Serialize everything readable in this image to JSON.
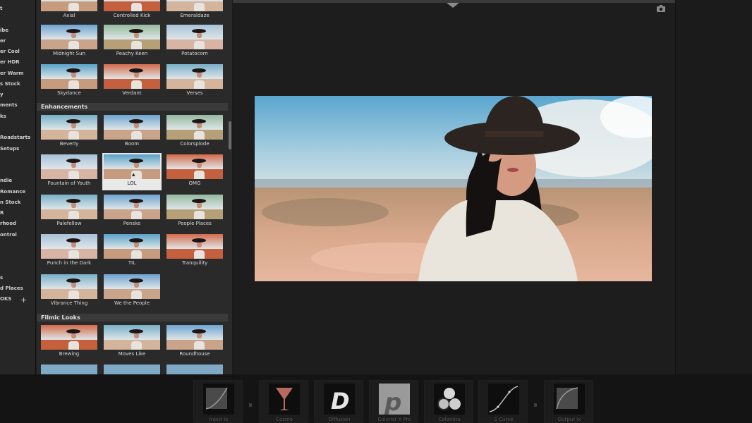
{
  "sidebar": {
    "categories": [
      "t",
      "ibe",
      "er",
      "er Cool",
      "er HDR",
      "er Warm",
      "s Stock",
      "y",
      "ments",
      "ks",
      "Roadstarts",
      "Setups",
      "ndie",
      "Romance",
      "n Stock",
      "R",
      "rhood",
      "ontrol",
      "s",
      "d Places",
      "OKS"
    ],
    "add_label": "+"
  },
  "browser": {
    "row0": [
      "Axial",
      "Controlled Kick",
      "Emeraldaze"
    ],
    "row1": [
      "Midnight Sun",
      "Peachy Keen",
      "Potatocorn"
    ],
    "row2": [
      "Skydance",
      "Verdant",
      "Verses"
    ],
    "section_enhancements": "Enhancements",
    "enh": [
      "Beverly",
      "Boom",
      "Colorsplode",
      "Fountain of Youth",
      "LOL",
      "OMG",
      "Palefellow",
      "Penske",
      "People Places",
      "Punch in the Dark",
      "TIL",
      "Tranquility",
      "Vibrance Thing",
      "We the People"
    ],
    "section_filmic": "Filmic Looks",
    "filmic": [
      "Brewing",
      "Moves Like",
      "Roundhouse"
    ]
  },
  "tools": [
    "Input Ix",
    "Cosmo",
    "Diffusion",
    "Colorist X Pro",
    "Colorista",
    "S Curve",
    "Output Ix"
  ],
  "colors": {
    "panel": "#2a2a2a",
    "selected": "#e9e9e9",
    "viewer": "#1d1d1d"
  },
  "icons": [
    "camera-icon",
    "star-icon",
    "cursor-icon",
    "plus-icon"
  ]
}
